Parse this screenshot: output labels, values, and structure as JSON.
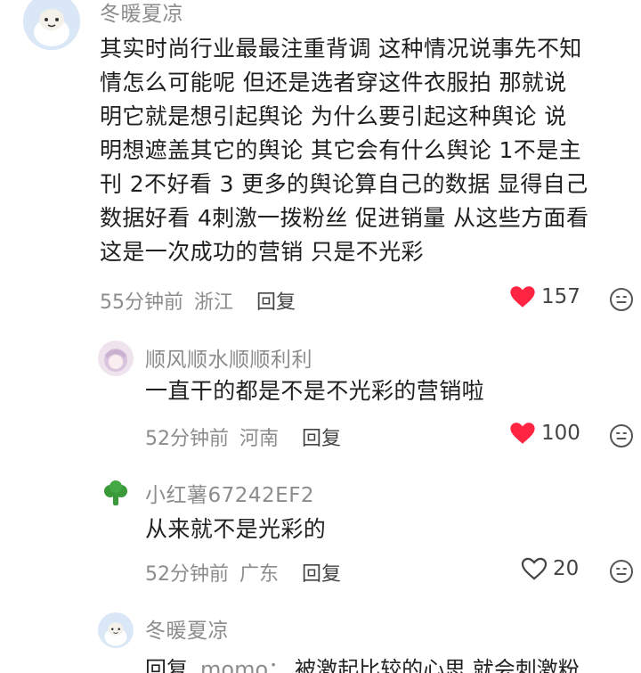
{
  "main_comment": {
    "username": "冬暖夏凉",
    "text": "其实时尚行业最最注重背调 这种情况说事先不知\n情怎么可能呢 但还是选者穿这件衣服拍 那就说\n明它就是想引起舆论 为什么要引起这种舆论 说\n明想遮盖其它的舆论 其它会有什么舆论 1不是主\n刊 2不好看 3 更多的舆论算自己的数据 显得自己\n数据好看 4刺激一拨粉丝 促进销量 从这些方面看\n这是一次成功的营销 只是不光彩",
    "time": "55分钟前",
    "location": "浙江",
    "reply_label": "回复",
    "likes": "157",
    "liked": true
  },
  "replies": [
    {
      "username": "顺风顺水顺顺利利",
      "text": "一直干的都是不是不光彩的营销啦",
      "time": "52分钟前",
      "location": "河南",
      "reply_label": "回复",
      "likes": "100",
      "liked": true
    },
    {
      "username": "小红薯67242EF2",
      "text": "从来就不是光彩的",
      "time": "52分钟前",
      "location": "广东",
      "reply_label": "回复",
      "likes": "20",
      "liked": false
    },
    {
      "username": "冬暖夏凉",
      "reply_label": "回复",
      "reply_to": "momo：",
      "text": "被激起比较的心思 就会刺激粉"
    }
  ],
  "colors": {
    "heart_active": "#ff2442",
    "muted_text": "#8c8c8c"
  }
}
